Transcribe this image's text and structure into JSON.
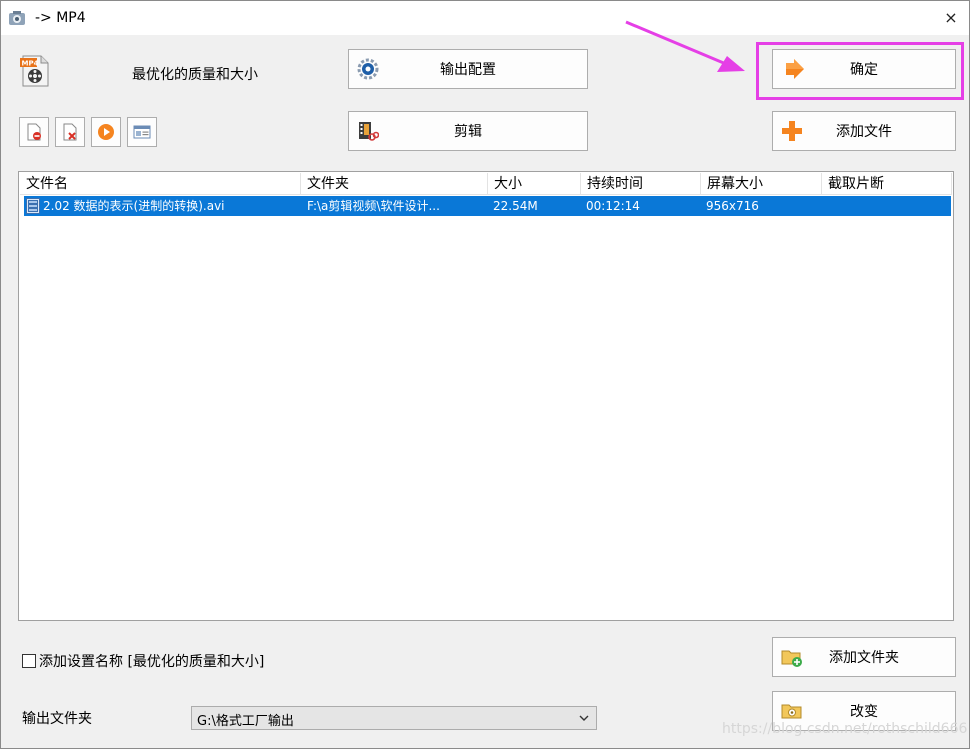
{
  "window": {
    "title": "-> MP4",
    "close_glyph": "×"
  },
  "preset": {
    "label": "最优化的质量和大小",
    "icon": "mp4-file-icon"
  },
  "buttons": {
    "output_config": "输出配置",
    "clip": "剪辑",
    "confirm": "确定",
    "add_file": "添加文件",
    "add_folder": "添加文件夹",
    "change": "改变"
  },
  "toolbar_icons": [
    "remove-file-icon",
    "clear-list-icon",
    "play-icon",
    "media-info-icon"
  ],
  "file_list": {
    "columns": [
      "文件名",
      "文件夹",
      "大小",
      "持续时间",
      "屏幕大小",
      "截取片断"
    ],
    "rows": [
      {
        "name": "2.02  数据的表示(进制的转换).avi",
        "folder": "F:\\a剪辑视频\\软件设计...",
        "size": "22.54M",
        "duration": "00:12:14",
        "resolution": "956x716",
        "clip": ""
      }
    ]
  },
  "options": {
    "add_setting_name": "添加设置名称 [最优化的质量和大小]",
    "add_setting_checked": false
  },
  "output": {
    "label": "输出文件夹",
    "folder": "G:\\格式工厂输出"
  },
  "watermark": "https://blog.csdn.net/rothschild666",
  "colors": {
    "selection": "#0a78d7",
    "highlight_box": "#e53fe6",
    "accent_orange": "#f5841f"
  }
}
